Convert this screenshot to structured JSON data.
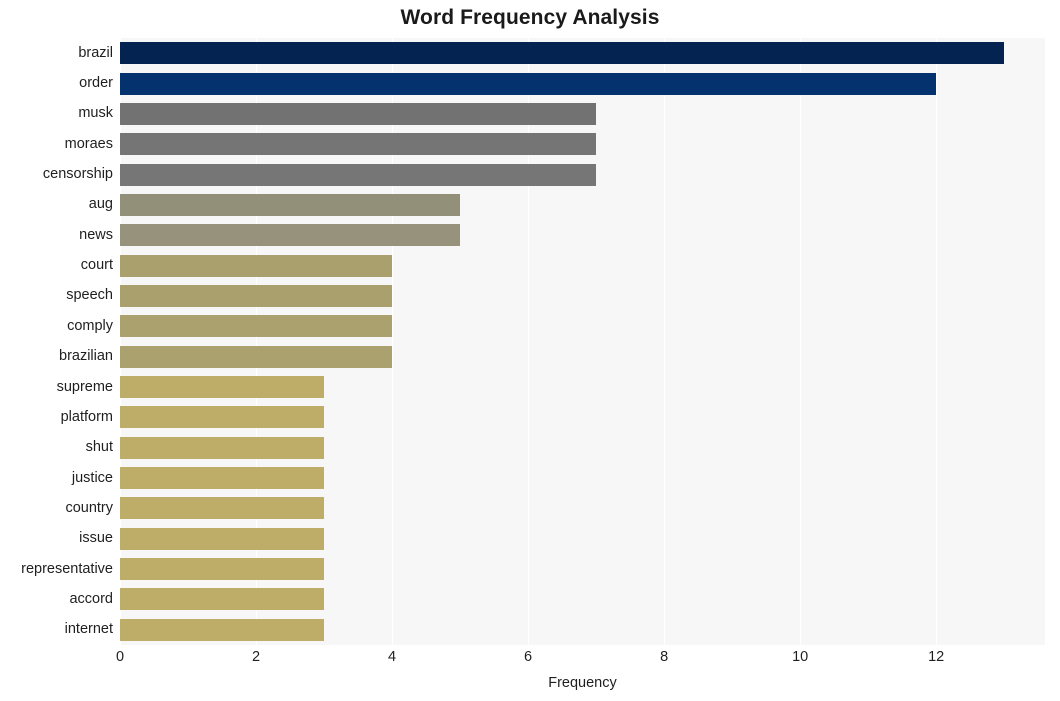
{
  "chart_data": {
    "type": "bar",
    "orientation": "horizontal",
    "title": "Word Frequency Analysis",
    "xlabel": "Frequency",
    "ylabel": "",
    "xlim": [
      0,
      13.6
    ],
    "ylim": [
      0,
      20
    ],
    "grid": true,
    "legend": false,
    "xticks": [
      0,
      2,
      4,
      6,
      8,
      10,
      12
    ],
    "xticklabels": [
      "0",
      "2",
      "4",
      "6",
      "8",
      "10",
      "12"
    ],
    "categories": [
      "brazil",
      "order",
      "musk",
      "moraes",
      "censorship",
      "aug",
      "news",
      "court",
      "speech",
      "comply",
      "brazilian",
      "supreme",
      "platform",
      "shut",
      "justice",
      "country",
      "issue",
      "representative",
      "accord",
      "internet"
    ],
    "values": [
      13,
      12,
      7,
      7,
      7,
      5,
      5,
      4,
      4,
      4,
      4,
      3,
      3,
      3,
      3,
      3,
      3,
      3,
      3,
      3
    ],
    "bar_colors": [
      "#052350",
      "#04326f",
      "#727272",
      "#757575",
      "#767676",
      "#93907a",
      "#96927b",
      "#a9a06e",
      "#a9a06e",
      "#aaa16f",
      "#aaa16f",
      "#bdad69",
      "#bdad69",
      "#bdad69",
      "#bdad69",
      "#bdad69",
      "#bdad69",
      "#bdad69",
      "#bdad69",
      "#bdad69"
    ]
  },
  "style": {
    "plot_background": "#f7f7f8",
    "figure_background": "#ffffff",
    "gridline_color": "#ffffff",
    "text_color": "#1f1f1f",
    "title_color": "#1a1a1a"
  }
}
